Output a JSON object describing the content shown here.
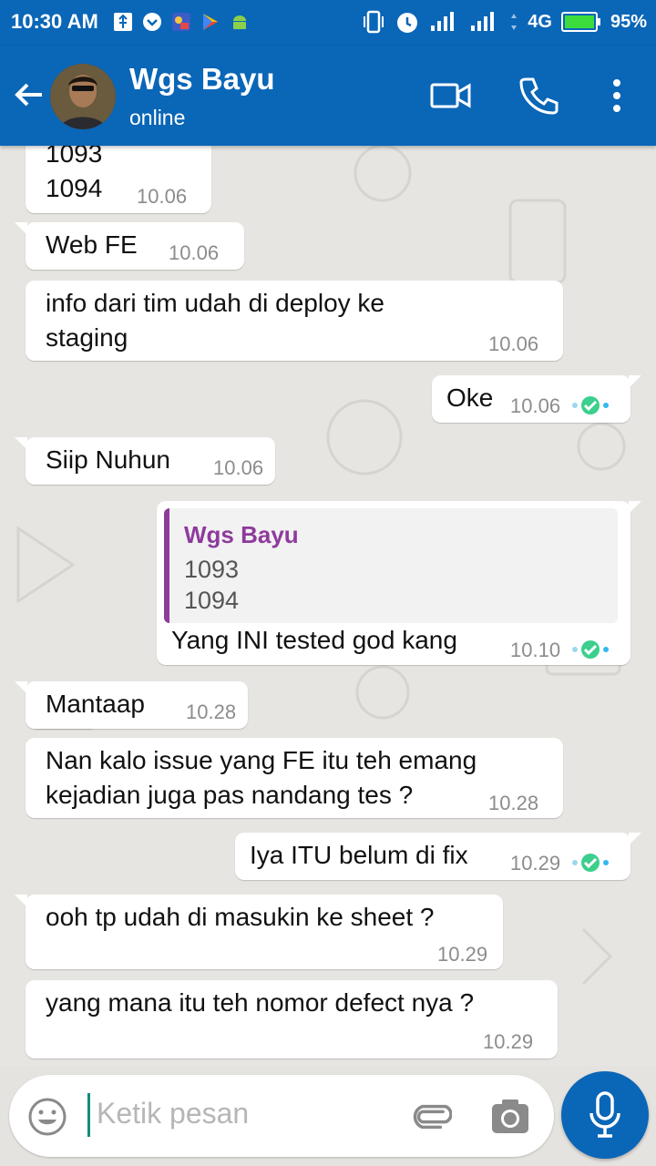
{
  "status_bar": {
    "time": "10:30 AM",
    "network": "4G",
    "battery": "95%"
  },
  "header": {
    "contact_name": "Wgs Bayu",
    "status": "online",
    "icons": [
      "back-arrow-icon",
      "video-call-icon",
      "phone-icon",
      "more-vert-icon"
    ]
  },
  "messages": [
    {
      "dir": "in",
      "lines": [
        "1093",
        "1094"
      ],
      "time": "10.06"
    },
    {
      "dir": "in",
      "lines": [
        "Web FE"
      ],
      "time": "10.06"
    },
    {
      "dir": "in",
      "lines": [
        "info dari tim udah di deploy ke",
        "staging"
      ],
      "time": "10.06"
    },
    {
      "dir": "out",
      "lines": [
        "Oke"
      ],
      "time": "10.06",
      "status": "read"
    },
    {
      "dir": "in",
      "lines": [
        "Siip Nuhun"
      ],
      "time": "10.06"
    },
    {
      "dir": "out",
      "quote": {
        "author": "Wgs Bayu",
        "lines": [
          "1093",
          "1094"
        ]
      },
      "lines": [
        "Yang INI tested god kang"
      ],
      "time": "10.10",
      "status": "read"
    },
    {
      "dir": "in",
      "lines": [
        "Mantaap"
      ],
      "time": "10.28"
    },
    {
      "dir": "in",
      "lines": [
        "Nan kalo issue yang FE itu teh emang",
        "kejadian juga pas nandang tes ?"
      ],
      "time": "10.28"
    },
    {
      "dir": "out",
      "lines": [
        "Iya ITU belum di fix"
      ],
      "time": "10.29",
      "status": "read"
    },
    {
      "dir": "in",
      "lines": [
        "ooh tp udah di masukin ke sheet ?"
      ],
      "time": "10.29"
    },
    {
      "dir": "in",
      "lines": [
        "yang mana itu teh nomor defect nya ?"
      ],
      "time": "10.29"
    }
  ],
  "input": {
    "placeholder": "Ketik pesan"
  },
  "colors": {
    "header": "#0a66b7",
    "quote_accent": "#8e3a9c",
    "read_tick": "#34b7f1"
  }
}
